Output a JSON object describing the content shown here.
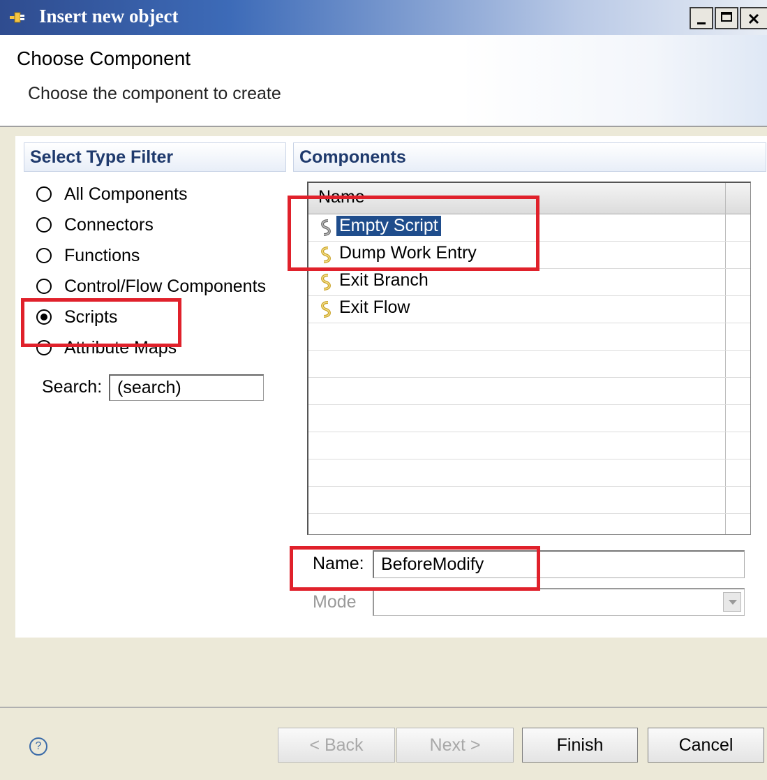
{
  "window": {
    "title": "Insert new object"
  },
  "header": {
    "title": "Choose Component",
    "subtitle": "Choose the component to create"
  },
  "filter": {
    "title": "Select Type Filter",
    "options": [
      "All Components",
      "Connectors",
      "Functions",
      "Control/Flow Components",
      "Scripts",
      "Attribute Maps"
    ],
    "selected": "Scripts",
    "search_label": "Search:",
    "search_value": "(search)"
  },
  "components": {
    "title": "Components",
    "column_header": "Name",
    "items": [
      "Empty Script",
      "Dump Work Entry",
      "Exit Branch",
      "Exit Flow"
    ],
    "selected": "Empty Script"
  },
  "form": {
    "name_label": "Name:",
    "name_value": "BeforeModify",
    "mode_label": "Mode",
    "mode_value": ""
  },
  "buttons": {
    "back": "< Back",
    "next": "Next >",
    "finish": "Finish",
    "cancel": "Cancel"
  },
  "colors": {
    "highlight": "#e0212b",
    "selection": "#1f4d8c",
    "titlebar": "#2f4c8f"
  },
  "icons": {
    "window": "plug-icon",
    "script": "script-icon",
    "help": "help-icon"
  }
}
